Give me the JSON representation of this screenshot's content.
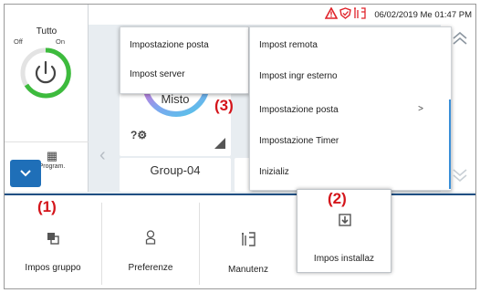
{
  "status": {
    "datetime": "06/02/2019 Me 01:47 PM",
    "icons": [
      "warning-icon",
      "shield-icon",
      "maintenance-icon"
    ]
  },
  "left_panel": {
    "title": "Tutto",
    "off_label": "Off",
    "on_label": "On",
    "schedule_label": "Program."
  },
  "tiles": [
    {
      "name": "Misto"
    },
    {
      "name": "Group-04"
    }
  ],
  "menus": {
    "left": [
      {
        "label": "Impostazione posta"
      },
      {
        "label": "Impost server"
      }
    ],
    "right": [
      {
        "label": "Impost remota"
      },
      {
        "label": "Impost ingr esterno"
      },
      {
        "label": "Impostazione posta",
        "arrow": ">"
      },
      {
        "label": "Impostazione Timer"
      },
      {
        "label": "Inizializ"
      }
    ]
  },
  "bottom_bar": [
    {
      "label": "Impos gruppo",
      "icon": "group-settings-icon"
    },
    {
      "label": "Preferenze",
      "icon": "user-icon"
    },
    {
      "label": "Manutenz",
      "icon": "maintenance-icon"
    },
    {
      "label": "Impos installaz",
      "icon": "download-icon"
    }
  ],
  "callouts": {
    "one": "(1)",
    "two": "(2)",
    "three": "(3)"
  },
  "colors": {
    "accent_blue": "#1f6fb8",
    "callout_red": "#d4151b",
    "power_green": "#3dbb3d",
    "warning_red": "#e0242b"
  }
}
